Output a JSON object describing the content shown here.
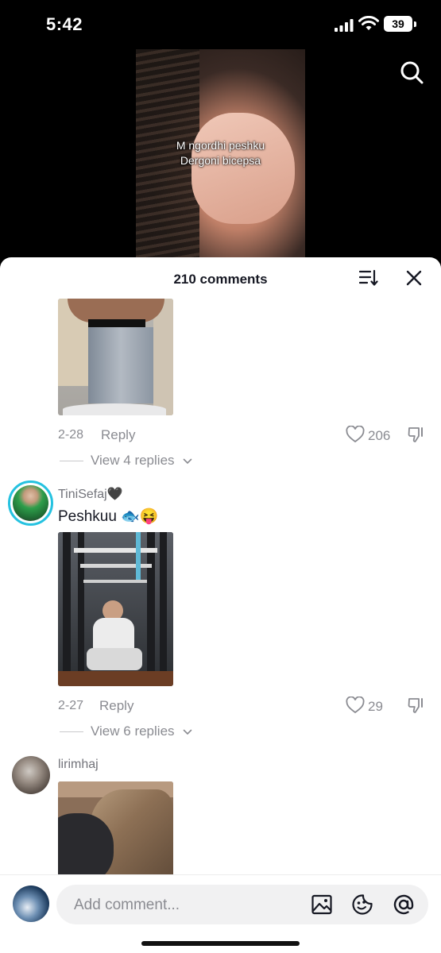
{
  "status_bar": {
    "time": "5:42",
    "battery": "39"
  },
  "video": {
    "caption_line1": "M ngordhi peshku",
    "caption_line2": "Dergoni bicepsa"
  },
  "sheet": {
    "title": "210 comments"
  },
  "comments": [
    {
      "date": "2-28",
      "reply_label": "Reply",
      "likes": "206",
      "view_replies": "View 4 replies"
    },
    {
      "username": "TiniSefaj🖤",
      "text": "Peshkuu 🐟😝",
      "date": "2-27",
      "reply_label": "Reply",
      "likes": "29",
      "view_replies": "View 6 replies"
    },
    {
      "username": "lirimhaj"
    }
  ],
  "footer": {
    "placeholder": "Add comment..."
  }
}
